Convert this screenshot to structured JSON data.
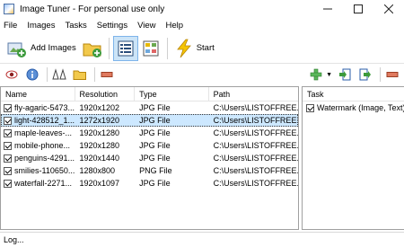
{
  "window": {
    "title": "Image Tuner - For personal use only"
  },
  "menu": [
    "File",
    "Images",
    "Tasks",
    "Settings",
    "View",
    "Help"
  ],
  "toolbar": {
    "add_images_label": "Add Images",
    "start_label": "Start"
  },
  "files": {
    "columns": {
      "name": "Name",
      "resolution": "Resolution",
      "type": "Type",
      "path": "Path"
    },
    "rows": [
      {
        "name": "fly-agaric-5473...",
        "resolution": "1920x1202",
        "type": "JPG File",
        "path": "C:\\Users\\LISTOFFREE..."
      },
      {
        "name": "light-428512_1...",
        "resolution": "1272x1920",
        "type": "JPG File",
        "path": "C:\\Users\\LISTOFFREE..."
      },
      {
        "name": "maple-leaves-...",
        "resolution": "1920x1280",
        "type": "JPG File",
        "path": "C:\\Users\\LISTOFFREE..."
      },
      {
        "name": "mobile-phone...",
        "resolution": "1920x1280",
        "type": "JPG File",
        "path": "C:\\Users\\LISTOFFREE..."
      },
      {
        "name": "penguins-4291...",
        "resolution": "1920x1440",
        "type": "JPG File",
        "path": "C:\\Users\\LISTOFFREE..."
      },
      {
        "name": "smilies-110650...",
        "resolution": "1280x800",
        "type": "PNG File",
        "path": "C:\\Users\\LISTOFFREE..."
      },
      {
        "name": "waterfall-2271...",
        "resolution": "1920x1097",
        "type": "JPG File",
        "path": "C:\\Users\\LISTOFFREE..."
      }
    ]
  },
  "tasks": {
    "header": "Task",
    "items": [
      {
        "label": "Watermark (Image, Text)"
      }
    ]
  },
  "status": {
    "text": "Log..."
  }
}
